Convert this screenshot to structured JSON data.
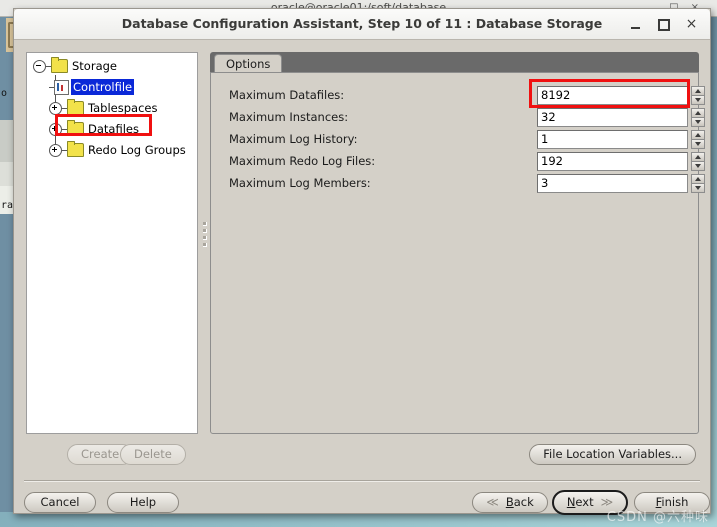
{
  "background": {
    "terminal_title": "oracle@oracle01:/soft/database",
    "window_controls": {
      "minimize": "_",
      "maximize": "□",
      "close": "×"
    },
    "edge_text_1": "o",
    "edge_text_2": "ra"
  },
  "dialog": {
    "title": "Database Configuration Assistant, Step 10 of 11 : Database Storage",
    "controls": {
      "minimize_label": "minimize",
      "maximize_label": "maximize",
      "close_label": "×"
    }
  },
  "tree": {
    "root": {
      "label": "Storage",
      "expanded": true
    },
    "nodes": [
      {
        "label": "Controlfile",
        "icon": "controlfile-icon",
        "selected": true,
        "expandable": false
      },
      {
        "label": "Tablespaces",
        "icon": "folder-icon",
        "selected": false,
        "expandable": true
      },
      {
        "label": "Datafiles",
        "icon": "folder-icon",
        "selected": false,
        "expandable": true
      },
      {
        "label": "Redo Log Groups",
        "icon": "folder-icon",
        "selected": false,
        "expandable": true
      }
    ]
  },
  "tabs": {
    "active": "Options",
    "items": [
      {
        "label": "Options"
      }
    ]
  },
  "form": {
    "fields": [
      {
        "label": "Maximum Datafiles:",
        "value": "8192",
        "focused": true
      },
      {
        "label": "Maximum Instances:",
        "value": "32",
        "focused": false
      },
      {
        "label": "Maximum Log History:",
        "value": "1",
        "focused": false
      },
      {
        "label": "Maximum Redo Log Files:",
        "value": "192",
        "focused": false
      },
      {
        "label": "Maximum Log Members:",
        "value": "3",
        "focused": false
      }
    ]
  },
  "actions": {
    "create": "Create",
    "delete": "Delete",
    "file_location_variables": "File Location Variables..."
  },
  "navigation": {
    "cancel": "Cancel",
    "help": "Help",
    "back": "Back",
    "back_mnemonic": "B",
    "back_rest": "ack",
    "next": "Next",
    "next_mnemonic": "N",
    "next_rest": "ext",
    "finish": "Finish",
    "finish_mnemonic": "F",
    "finish_rest": "inish",
    "back_chevron": "≪",
    "next_chevron": "≫"
  },
  "watermark": "CSDN @六种味",
  "colors": {
    "selection_blue": "#0a28d8",
    "highlight_red": "#f01010",
    "dialog_face": "#d4d0c8",
    "tab_strip": "#6a6a6a"
  }
}
